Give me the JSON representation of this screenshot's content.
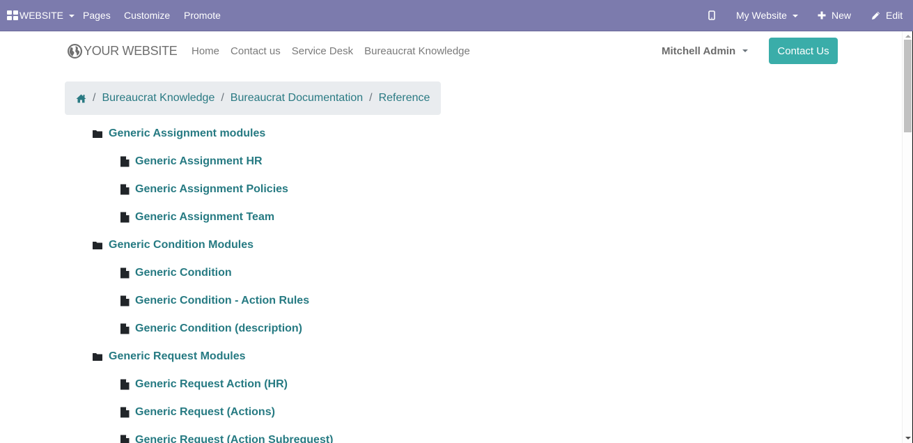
{
  "admin_bar": {
    "app_menu": {
      "label": "WEBSITE",
      "icon": "apps-icon"
    },
    "items": [
      {
        "label": "Pages"
      },
      {
        "label": "Customize"
      },
      {
        "label": "Promote"
      }
    ],
    "mobile_preview_icon": "mobile-icon",
    "website_switcher": {
      "label": "My Website"
    },
    "new_button": {
      "label": "New",
      "icon": "plus-icon"
    },
    "edit_button": {
      "label": "Edit",
      "icon": "pencil-icon"
    }
  },
  "header": {
    "brand": {
      "label": "YOUR WEBSITE",
      "icon": "globe-icon"
    },
    "nav": [
      {
        "label": "Home"
      },
      {
        "label": "Contact us"
      },
      {
        "label": "Service Desk"
      },
      {
        "label": "Bureaucrat Knowledge"
      }
    ],
    "user": {
      "label": "Mitchell Admin"
    },
    "cta": {
      "label": "Contact Us"
    }
  },
  "breadcrumb": {
    "home_icon": "home-icon",
    "separator": "/",
    "items": [
      {
        "label": "Bureaucrat Knowledge"
      },
      {
        "label": "Bureaucrat Documentation"
      },
      {
        "label": "Reference"
      }
    ]
  },
  "tree": [
    {
      "label": "Generic Assignment modules",
      "icon": "folder-icon",
      "children": [
        {
          "label": "Generic Assignment HR",
          "icon": "file-icon"
        },
        {
          "label": "Generic Assignment Policies",
          "icon": "file-icon"
        },
        {
          "label": "Generic Assignment Team",
          "icon": "file-icon"
        }
      ]
    },
    {
      "label": "Generic Condition Modules",
      "icon": "folder-icon",
      "children": [
        {
          "label": "Generic Condition",
          "icon": "file-icon"
        },
        {
          "label": "Generic Condition - Action Rules",
          "icon": "file-icon"
        },
        {
          "label": "Generic Condition (description)",
          "icon": "file-icon"
        }
      ]
    },
    {
      "label": "Generic Request Modules",
      "icon": "folder-icon",
      "children": [
        {
          "label": "Generic Request Action (HR)",
          "icon": "file-icon"
        },
        {
          "label": "Generic Request (Actions)",
          "icon": "file-icon"
        },
        {
          "label": "Generic Request (Action Subrequest)",
          "icon": "file-icon"
        }
      ]
    }
  ],
  "colors": {
    "admin_bar": "#7c7bad",
    "link": "#267a82",
    "cta": "#3aada9",
    "breadcrumb_bg": "#e9ecef"
  }
}
